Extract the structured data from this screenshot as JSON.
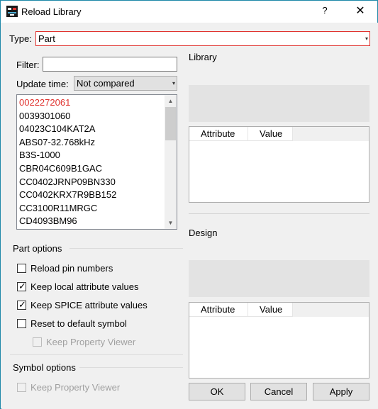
{
  "window": {
    "title": "Reload Library",
    "help_label": "?",
    "close_label": "✕",
    "icon": "app-icon"
  },
  "type_row": {
    "label": "Type:",
    "value": "Part"
  },
  "filter": {
    "label": "Filter:",
    "value": ""
  },
  "update_time": {
    "label": "Update time:",
    "value": "Not compared"
  },
  "parts_list": {
    "items": [
      "0022272061",
      "0039301060",
      "04023C104KAT2A",
      "ABS07-32.768kHz",
      "B3S-1000",
      "CBR04C609B1GAC",
      "CC0402JRNP09BN330",
      "CC0402KRX7R9BB152",
      "CC3100R11MRGC",
      "CD4093BM96"
    ],
    "first_item_color": "#e0322e"
  },
  "part_options": {
    "heading": "Part options",
    "reload_pin_numbers": {
      "label": "Reload pin numbers",
      "checked": false
    },
    "keep_local_attr": {
      "label": "Keep local attribute values",
      "checked": true
    },
    "keep_spice_attr": {
      "label": "Keep SPICE attribute values",
      "checked": true
    },
    "reset_default_symbol": {
      "label": "Reset to default symbol",
      "checked": false
    },
    "keep_property_viewer": {
      "label": "Keep Property Viewer",
      "checked": false,
      "enabled": false
    }
  },
  "symbol_options": {
    "heading": "Symbol options",
    "keep_property_viewer": {
      "label": "Keep Property Viewer",
      "checked": false,
      "enabled": false
    }
  },
  "library": {
    "heading": "Library",
    "columns": [
      "Attribute",
      "Value"
    ]
  },
  "design": {
    "heading": "Design",
    "columns": [
      "Attribute",
      "Value"
    ]
  },
  "buttons": {
    "ok": "OK",
    "cancel": "Cancel",
    "apply": "Apply"
  },
  "colors": {
    "accent_border": "#1e88a8",
    "error_red": "#e0322e"
  }
}
